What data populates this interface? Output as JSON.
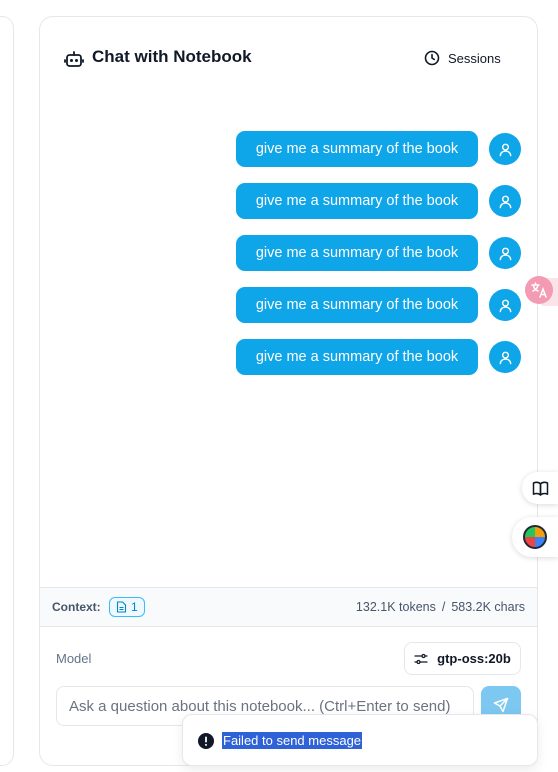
{
  "header": {
    "title": "Chat with Notebook",
    "sessions_label": "Sessions"
  },
  "messages": [
    {
      "role": "user",
      "text": "give me a summary of the book"
    },
    {
      "role": "user",
      "text": "give me a summary of the book"
    },
    {
      "role": "user",
      "text": "give me a summary of the book"
    },
    {
      "role": "user",
      "text": "give me a summary of the book"
    },
    {
      "role": "user",
      "text": "give me a summary of the book"
    }
  ],
  "context": {
    "label": "Context:",
    "source_count": "1",
    "tokens": "132.1K tokens",
    "separator": "/",
    "chars": "583.2K chars"
  },
  "model": {
    "label": "Model",
    "selected": "gtp-oss:20b"
  },
  "input": {
    "placeholder": "Ask a question about this notebook... (Ctrl+Enter to send)",
    "value": ""
  },
  "toast": {
    "message": "Failed to send message"
  },
  "icons": {
    "title_icon": "bot-icon",
    "sessions_icon": "clock-icon",
    "avatar_icon": "user-icon",
    "context_icon": "file-icon",
    "model_icon": "settings-sliders-icon",
    "send_icon": "send-icon",
    "toast_icon": "alert-circle-icon",
    "floating": [
      "translate-icon",
      "book-icon",
      "globe-icon"
    ]
  },
  "colors": {
    "accent": "#0ea5e9",
    "send_disabled": "#7cc8f0",
    "toast_highlight": "#2f62d6",
    "translate_badge": "#f29bb3"
  }
}
